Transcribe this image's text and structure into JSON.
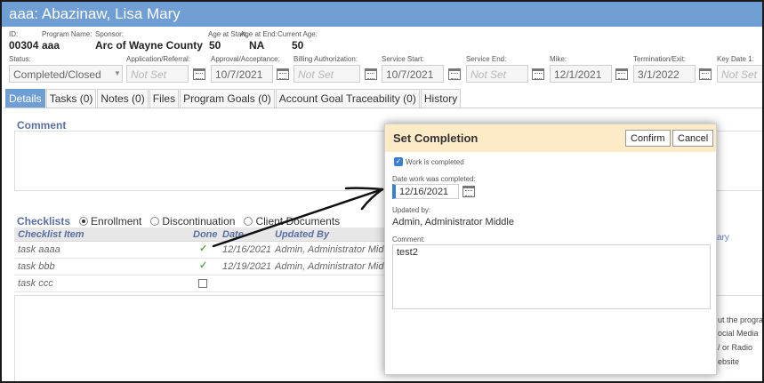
{
  "header": {
    "title": "aaa: Abazinaw, Lisa Mary"
  },
  "info": {
    "id_label": "ID:",
    "id_value": "00304",
    "program_label": "Program Name:",
    "program_value": "aaa",
    "sponsor_label": "Sponsor:",
    "sponsor_value": "Arc of Wayne County",
    "age_start_label": "Age at Start:",
    "age_start_value": "50",
    "age_end_label": "Age at End:",
    "age_end_value": "NA",
    "current_age_label": "Current Age:",
    "current_age_value": "50"
  },
  "fields": {
    "status_label": "Status:",
    "status_value": "Completed/Closed",
    "application_label": "Application/Referral:",
    "application_value": "Not Set",
    "approval_label": "Approval/Acceptance:",
    "approval_value": "10/7/2021",
    "billing_label": "Billing Authorization:",
    "billing_value": "Not Set",
    "service_start_label": "Service Start:",
    "service_start_value": "10/7/2021",
    "service_end_label": "Service End:",
    "service_end_value": "Not Set",
    "mike_label": "Mike:",
    "mike_value": "12/1/2021",
    "termination_label": "Termination/Exit:",
    "termination_value": "3/1/2022",
    "key_date_label": "Key Date 1:",
    "key_date_value": "Not Set"
  },
  "tabs": [
    {
      "label": "Details"
    },
    {
      "label": "Tasks (0)"
    },
    {
      "label": "Notes (0)"
    },
    {
      "label": "Files"
    },
    {
      "label": "Program Goals (0)"
    },
    {
      "label": "Account Goal Traceability (0)"
    },
    {
      "label": "History"
    }
  ],
  "comment_section": {
    "title": "Comment"
  },
  "checklists": {
    "title": "Checklists",
    "options": [
      "Enrollment",
      "Discontinuation",
      "Client Documents"
    ],
    "columns": {
      "item": "Checklist Item",
      "done": "Done",
      "date": "Date",
      "updated_by": "Updated By"
    },
    "rows": [
      {
        "item": "task aaaa",
        "done": "✓",
        "date": "12/16/2021",
        "updated_by": "Admin, Administrator Middle"
      },
      {
        "item": "task bbb",
        "done": "✓",
        "date": "12/19/2021",
        "updated_by": "Admin, Administrator Middle"
      },
      {
        "item": "task ccc",
        "done": "",
        "date": "",
        "updated_by": ""
      }
    ]
  },
  "background_right": {
    "link": "ary",
    "lines": [
      "ut the program",
      "ocial Media",
      "/ or Radio",
      "ebsite"
    ]
  },
  "modal": {
    "title": "Set Completion",
    "confirm_label": "Confirm",
    "cancel_label": "Cancel",
    "work_completed_label": "Work is completed",
    "date_label": "Date work was completed:",
    "date_value": "12/16/2021",
    "updated_by_label": "Updated by:",
    "updated_by_value": "Admin, Administrator Middle",
    "comment_label": "Comment:",
    "comment_value": "test2"
  },
  "colors": {
    "header_blue": "#6f9ed4",
    "modal_header": "#fdebc8",
    "accent_blue": "#3b7fd4",
    "check_green": "#5aa845"
  }
}
